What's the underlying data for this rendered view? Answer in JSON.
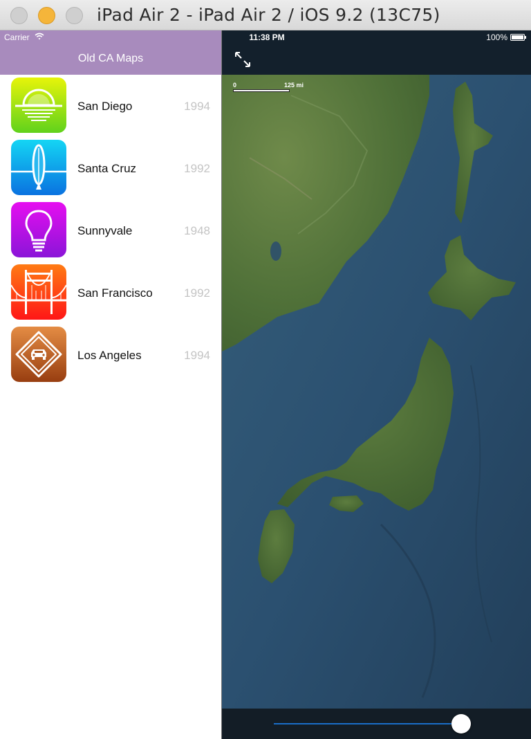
{
  "window": {
    "title": "iPad Air 2 - iPad Air 2 / iOS 9.2 (13C75)"
  },
  "status_bar": {
    "carrier": "Carrier",
    "time": "11:38 PM",
    "battery": "100%"
  },
  "master": {
    "title": "Old CA Maps",
    "items": [
      {
        "title": "San Diego",
        "year": "1994",
        "icon": "sunset-icon"
      },
      {
        "title": "Santa Cruz",
        "year": "1992",
        "icon": "surfboard-icon"
      },
      {
        "title": "Sunnyvale",
        "year": "1948",
        "icon": "lightbulb-icon"
      },
      {
        "title": "San Francisco",
        "year": "1992",
        "icon": "golden-gate-bridge-icon"
      },
      {
        "title": "Los Angeles",
        "year": "1994",
        "icon": "car-road-sign-icon"
      }
    ]
  },
  "detail": {
    "scale": {
      "min": "0",
      "max": "125 mi"
    },
    "opacity_slider_value": 0.96
  },
  "colors": {
    "nav_accent": "#a88bbd",
    "slider_accent": "#1a6ec8"
  }
}
